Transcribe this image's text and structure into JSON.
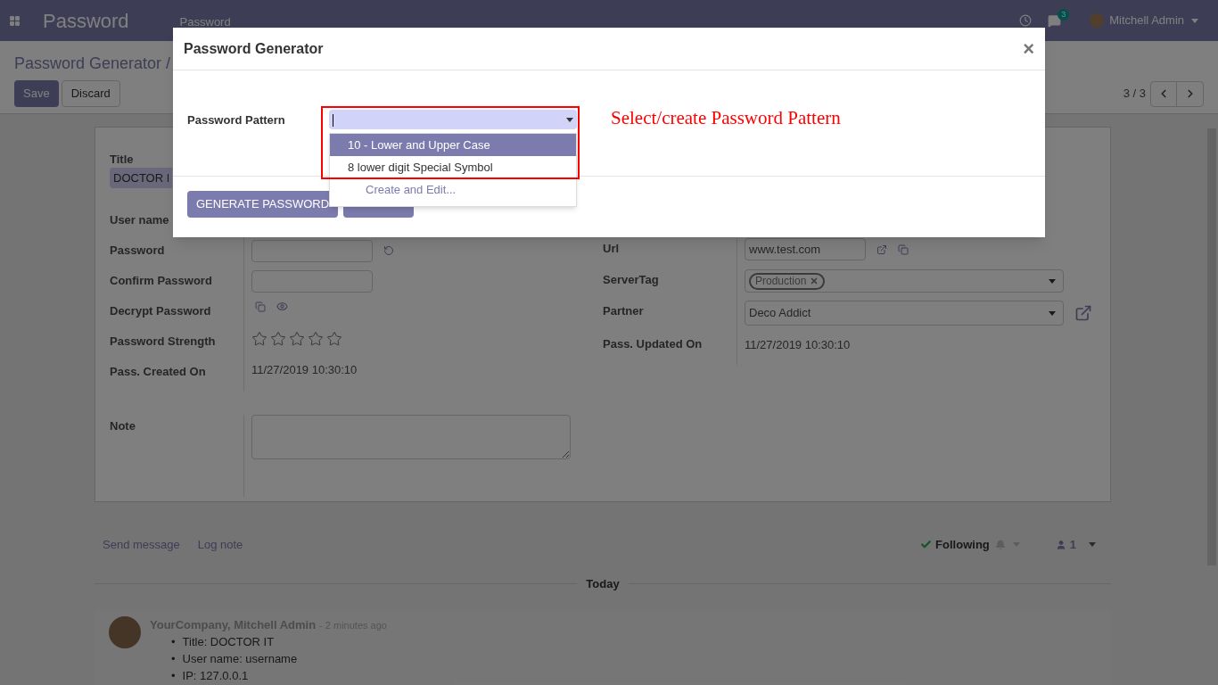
{
  "navbar": {
    "brand": "Password",
    "menu": "Password",
    "chat_badge": "3",
    "user": "Mitchell Admin"
  },
  "control_panel": {
    "breadcrumb": "Password Generator /",
    "save": "Save",
    "discard": "Discard",
    "pager": "3 / 3"
  },
  "form": {
    "title_label": "Title",
    "title_value": "DOCTOR I",
    "left": [
      {
        "kind": "text",
        "label": "User name"
      },
      {
        "kind": "input",
        "label": "Password"
      },
      {
        "kind": "input",
        "label": "Confirm Password"
      },
      {
        "kind": "actions",
        "label": "Decrypt Password"
      },
      {
        "kind": "stars",
        "label": "Password Strength",
        "stars": 0
      },
      {
        "kind": "text",
        "label": "Pass. Created On",
        "value": "11/27/2019 10:30:10"
      }
    ],
    "note_label": "Note",
    "right": [
      {
        "kind": "url",
        "label": "Url",
        "value": "www.test.com"
      },
      {
        "kind": "tags",
        "label": "ServerTag",
        "tags": [
          "Production"
        ]
      },
      {
        "kind": "select",
        "label": "Partner",
        "value": "Deco Addict"
      },
      {
        "kind": "text",
        "label": "Pass. Updated On",
        "value": "11/27/2019 10:30:10"
      }
    ]
  },
  "chatter": {
    "send_message": "Send message",
    "log_note": "Log note",
    "following": "Following",
    "followers": "1",
    "divider": "Today",
    "message": {
      "author": "YourCompany, Mitchell Admin",
      "time": "- 2 minutes ago",
      "bullet": "•",
      "lines": [
        "Title: DOCTOR IT",
        "User name: username",
        "IP: 127.0.0.1"
      ]
    }
  },
  "dialog": {
    "title": "Password Generator",
    "close": "×",
    "field_label": "Password Pattern",
    "options": [
      {
        "label": "10 - Lower and Upper Case",
        "selected": true
      },
      {
        "label": "8 lower digit Special Symbol",
        "selected": false
      }
    ],
    "create_edit": "Create and Edit...",
    "annotation": "Select/create Password Pattern",
    "generate": "GENERATE PASSWORD"
  }
}
